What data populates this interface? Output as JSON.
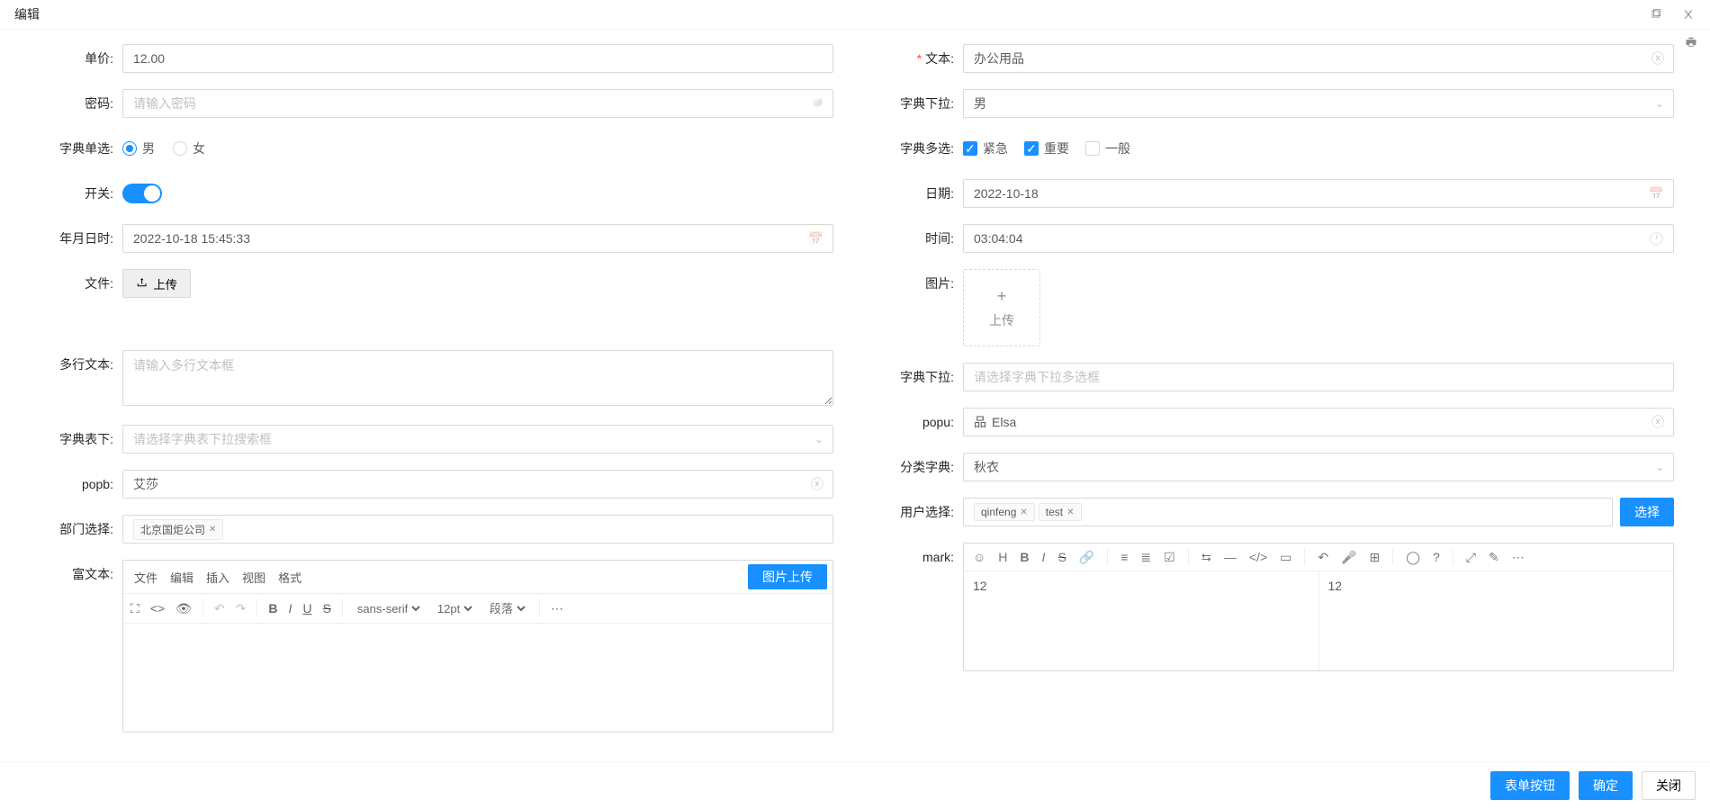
{
  "header": {
    "title": "编辑"
  },
  "left": {
    "price": {
      "label": "单价:",
      "value": "12.00"
    },
    "password": {
      "label": "密码:",
      "placeholder": "请输入密码"
    },
    "dict_radio": {
      "label": "字典单选:",
      "opt1": "男",
      "opt2": "女"
    },
    "switch": {
      "label": "开关:"
    },
    "datetime": {
      "label": "年月日时:",
      "value": "2022-10-18 15:45:33"
    },
    "file": {
      "label": "文件:",
      "btn": "上传"
    },
    "multiline": {
      "label": "多行文本:",
      "placeholder": "请输入多行文本框"
    },
    "dict_search": {
      "label": "字典表下:",
      "placeholder": "请选择字典表下拉搜索框"
    },
    "popb": {
      "label": "popb:",
      "value": "艾莎"
    },
    "dept": {
      "label": "部门选择:",
      "tag1": "北京国炬公司"
    },
    "richtext": {
      "label": "富文本:",
      "menu": {
        "file": "文件",
        "edit": "编辑",
        "insert": "插入",
        "view": "视图",
        "format": "格式"
      },
      "img_upload": "图片上传",
      "font": "sans-serif",
      "size": "12pt",
      "para": "段落"
    }
  },
  "right": {
    "text": {
      "label": "文本:",
      "value": "办公用品"
    },
    "dict_select": {
      "label": "字典下拉:",
      "value": "男"
    },
    "dict_multi": {
      "label": "字典多选:",
      "opt1": "紧急",
      "opt2": "重要",
      "opt3": "一般"
    },
    "date": {
      "label": "日期:",
      "value": "2022-10-18"
    },
    "time": {
      "label": "时间:",
      "value": "03:04:04"
    },
    "image": {
      "label": "图片:",
      "btn": "上传"
    },
    "dict_multi_select": {
      "label": "字典下拉:",
      "placeholder": "请选择字典下拉多选框"
    },
    "popu": {
      "label": "popu:",
      "value": "Elsa"
    },
    "cat_dict": {
      "label": "分类字典:",
      "value": "秋衣"
    },
    "user_select": {
      "label": "用户选择:",
      "tag1": "qinfeng",
      "tag2": "test",
      "btn": "选择"
    },
    "mark": {
      "label": "mark:",
      "src": "12",
      "prev": "12"
    }
  },
  "footer": {
    "form_btn": "表单按钮",
    "ok": "确定",
    "close": "关闭"
  }
}
